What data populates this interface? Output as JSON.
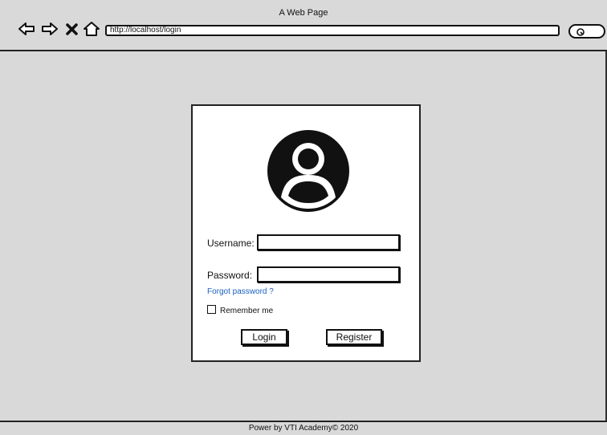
{
  "window": {
    "title": "A Web Page"
  },
  "address_bar": {
    "url": "http://localhost/login"
  },
  "nav_icons": [
    "back-arrow-icon",
    "forward-arrow-icon",
    "close-icon",
    "home-icon"
  ],
  "login_form": {
    "username_label": "Username:",
    "username_value": "",
    "password_label": "Password:",
    "password_value": "",
    "forgot_password_link": "Forgot password ?",
    "remember_me_label": "Remember me",
    "remember_me_checked": false,
    "login_button": "Login",
    "register_button": "Register"
  },
  "footer": {
    "text": "Power by VTI Academy© 2020"
  },
  "colors": {
    "background": "#d9d9d9",
    "card": "#ffffff",
    "link": "#1a5fc4",
    "ink": "#111111"
  }
}
